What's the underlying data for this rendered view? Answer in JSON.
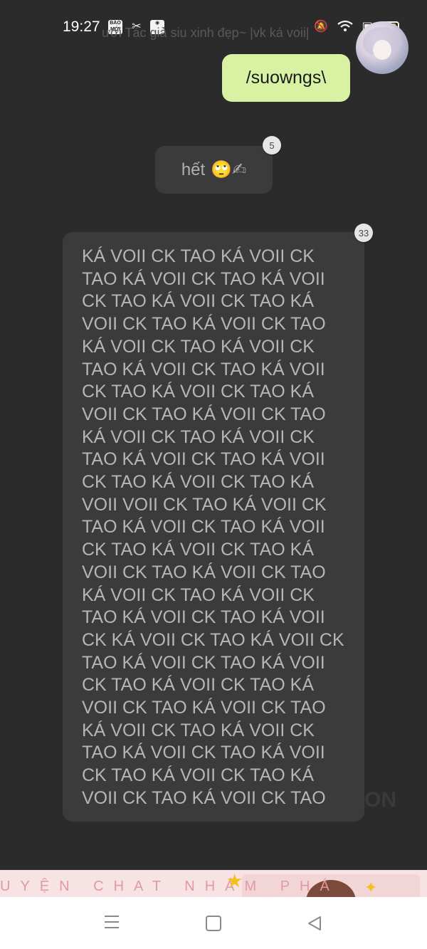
{
  "status_bar": {
    "time": "19:27",
    "app_icons": [
      "BÁO MỚI",
      "capcut-icon",
      "camera-icon"
    ],
    "right_icons": [
      "mute-icon",
      "wifi-icon",
      "screen-icon",
      "battery-icon"
    ],
    "battery_color": "#f3c11b"
  },
  "header": {
    "subtitle": "ưới Tác giả siu xinh đẹp~ |vk ká voii|"
  },
  "messages": [
    {
      "sender": "me",
      "text": "/suowngs\\",
      "bubble_color": "#d9f1a3"
    },
    {
      "sender": "other",
      "text": "hết",
      "emojis": "🙄✍",
      "reaction_count": "5"
    },
    {
      "sender": "other",
      "reaction_count": "33",
      "lines": [
        "KÁ VOII CK TAO KÁ VOII CK",
        "TAO KÁ VOII CK TAO KÁ VOII",
        "CK TAO KÁ VOII CK TAO KÁ",
        "VOII CK TAO KÁ VOII CK TAO",
        "KÁ VOII CK TAO KÁ VOII CK",
        "TAO KÁ VOII CK TAO KÁ VOII",
        "CK TAO KÁ VOII CK TAO KÁ",
        "VOII CK TAO KÁ VOII CK TAO",
        "KÁ VOII CK TAO KÁ VOII CK",
        "TAO KÁ VOII CK TAO KÁ VOII",
        "CK TAO KÁ VOII CK TAO KÁ",
        "VOII VOII CK TAO KÁ VOII CK",
        "TAO KÁ VOII CK TAO KÁ VOII",
        "CK TAO KÁ VOII CK TAO KÁ",
        "VOII CK TAO KÁ VOII CK TAO",
        "KÁ VOII CK TAO KÁ VOII CK",
        "TAO KÁ VOII CK TAO KÁ VOII",
        "CK KÁ VOII CK TAO KÁ VOII CK",
        "TAO KÁ VOII CK TAO KÁ VOII",
        "CK TAO KÁ VOII CK TAO KÁ",
        "VOII CK TAO KÁ VOII CK TAO",
        "KÁ VOII CK TAO KÁ VOII CK",
        "TAO KÁ VOII CK TAO KÁ VOII",
        "CK TAO KÁ VOII CK TAO KÁ",
        "VOII CK TAO KÁ VOII CK TAO"
      ]
    }
  ],
  "watermark": "ON",
  "ad_banner": {
    "text": "UYỆN CHAT NHÁM PHÁ"
  },
  "nav_bar": {
    "buttons": [
      "menu-icon",
      "home-icon",
      "back-icon"
    ]
  }
}
